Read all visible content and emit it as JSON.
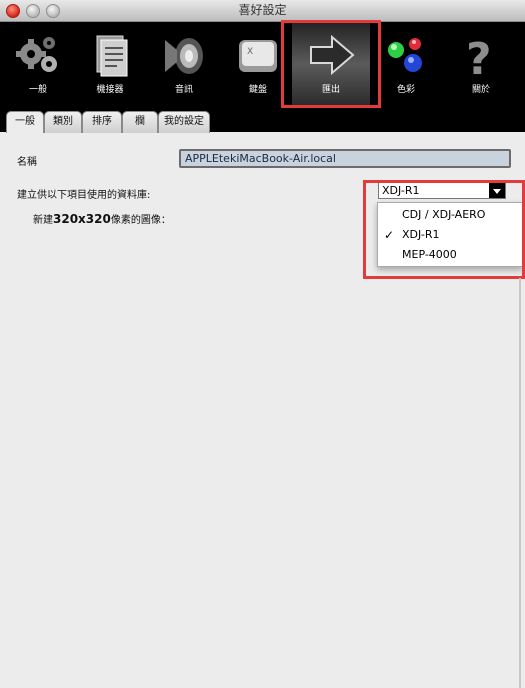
{
  "window": {
    "title": "喜好設定"
  },
  "toolbar": {
    "items": [
      {
        "label": "一般",
        "icon": "gears-icon"
      },
      {
        "label": "機接器",
        "icon": "document-icon"
      },
      {
        "label": "音訊",
        "icon": "speaker-icon"
      },
      {
        "label": "鍵盤",
        "icon": "key-icon"
      },
      {
        "label": "匯出",
        "icon": "arrow-right-icon"
      },
      {
        "label": "色彩",
        "icon": "color-balls-icon"
      },
      {
        "label": "關於",
        "icon": "question-icon"
      }
    ],
    "selected": "匯出"
  },
  "tabs": [
    {
      "label": "一般"
    },
    {
      "label": "類別"
    },
    {
      "label": "排序"
    },
    {
      "label": "欄"
    },
    {
      "label": "我的設定"
    }
  ],
  "form": {
    "name_label": "名稱",
    "name_value": "APPLEtekiMacBook-Air.local",
    "db_label": "建立供以下項目使用的資料庫:",
    "thumb_label_prefix": "新建",
    "thumb_label_bold": "320x320",
    "thumb_label_suffix": "像素的圖像："
  },
  "popup": {
    "selected": "XDJ-R1",
    "options": [
      "CDJ / XDJ-AERO",
      "XDJ-R1",
      "MEP-4000"
    ],
    "checked": "XDJ-R1"
  },
  "colors": {
    "highlight": "#e23b3b",
    "field_bg": "#c9d3de"
  }
}
